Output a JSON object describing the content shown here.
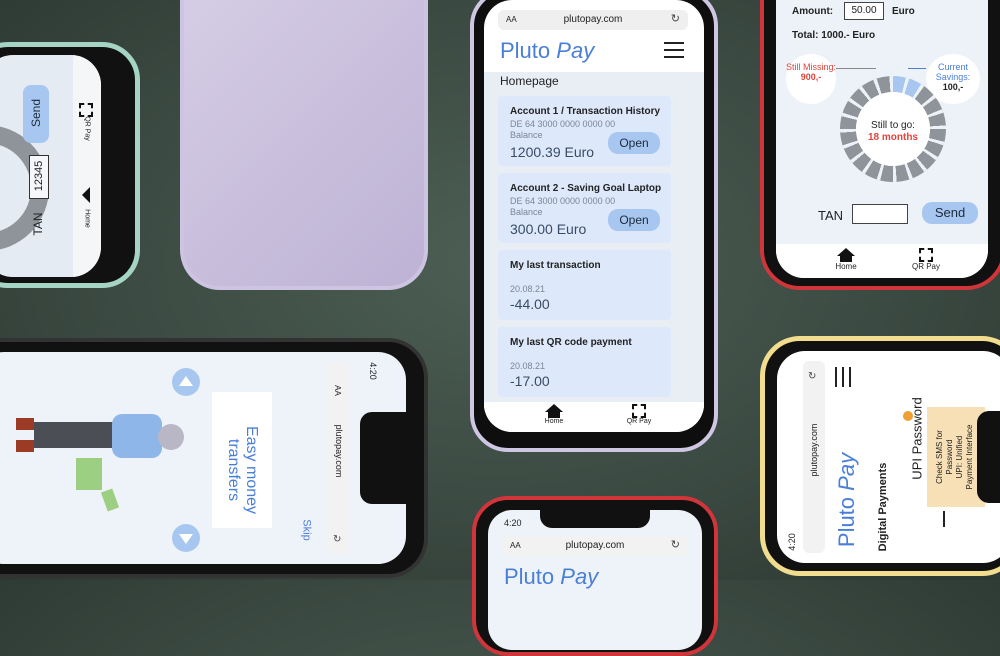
{
  "colors": {
    "accent": "#4a7fd8",
    "red_text": "#e0443a",
    "card": "#dde9fb",
    "button": "#a8c7f0"
  },
  "center_phone": {
    "url": "plutopay.com",
    "text_size_icon": "AA",
    "logo_a": "Pluto",
    "logo_b": "Pay",
    "page_title": "Homepage",
    "cards": [
      {
        "title": "Account 1 / Transaction History",
        "iban": "DE 64 3000 0000 0000  00",
        "balance_label": "Balance",
        "amount": "1200.39 Euro",
        "button": "Open"
      },
      {
        "title": "Account 2 - Saving Goal Laptop",
        "iban": "DE 64 3000 0000 0000  00",
        "balance_label": "Balance",
        "amount": "300.00 Euro",
        "button": "Open"
      },
      {
        "title": "My last transaction",
        "date": "20.08.21",
        "amount": "-44.00"
      },
      {
        "title": "My last QR code payment",
        "date": "20.08.21",
        "amount": "-17.00"
      }
    ],
    "nav": {
      "home": "Home",
      "qr": "QR Pay"
    }
  },
  "right_top_phone": {
    "amount_label": "Amount:",
    "amount_value": "50.00",
    "amount_unit": "Euro",
    "total": "Total: 1000.- Euro",
    "still_missing_label": "Still Missing:",
    "still_missing_value": "900,-",
    "current_savings_label": "Current Savings:",
    "current_savings_value": "100,-",
    "still_to_go_label": "Still to go:",
    "still_to_go_value": "18 months",
    "tan_label": "TAN",
    "send": "Send",
    "nav": {
      "home": "Home",
      "qr": "QR Pay"
    }
  },
  "left_top_phone": {
    "send": "Send",
    "tan_label": "TAN",
    "tan_value": "12345",
    "nav_home": "Home",
    "nav_qr": "QR Pay"
  },
  "left_bottom_phone": {
    "time": "4:20",
    "text_size_icon": "AA",
    "url": "plutopay.com",
    "headline_1": "Easy money",
    "headline_2": "transfers",
    "skip": "Skip"
  },
  "right_bottom_phone": {
    "time": "4:20",
    "url": "plutopay.com",
    "logo_a": "Pluto",
    "logo_b": "Pay",
    "subtitle": "Digital Payments",
    "upi_password": "UPI Password",
    "tooltip_1": "Check SMS for",
    "tooltip_2": "Password",
    "tooltip_3": "UPI: Unified",
    "tooltip_4": "Payment Interface"
  },
  "bottom_center_phone": {
    "time": "4:20",
    "text_size_icon": "AA",
    "url": "plutopay.com",
    "logo_a": "Pluto",
    "logo_b": "Pay"
  }
}
